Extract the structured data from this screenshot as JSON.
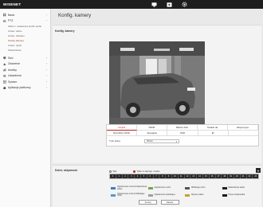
{
  "app": {
    "logo": "WISENET"
  },
  "header_icons": [
    "monitor-icon",
    "playback-icon",
    "settings-gear-icon"
  ],
  "sidebar": {
    "items": [
      {
        "label": "Basic",
        "icon": "grid-icon"
      },
      {
        "label": "PTZ",
        "icon": "ptz-icon"
      }
    ],
    "subitems": [
      {
        "label": "Wideo i ustawienia profilu audio",
        "active": false
      },
      {
        "label": "Ustaw. wideo",
        "active": false
      },
      {
        "label": "Ustaw. dźwięku",
        "active": false
      },
      {
        "label": "Konfig. kamery",
        "active": true
      },
      {
        "label": "Ustaw. ogóln.",
        "active": false
      },
      {
        "label": "Wskaźników",
        "active": false
      }
    ],
    "items2": [
      {
        "label": "Sieć",
        "icon": "network-icon"
      },
      {
        "label": "Zdarzenie",
        "icon": "event-icon"
      },
      {
        "label": "Analizy",
        "icon": "analytics-icon"
      },
      {
        "label": "Ustawienia",
        "icon": "settings-icon"
      },
      {
        "label": "System",
        "icon": "system-icon"
      },
      {
        "label": "Aplikacje platformy",
        "icon": "app-icon"
      }
    ]
  },
  "page": {
    "title": "Konfig. kamery"
  },
  "camera_section": {
    "label": "Konfig. kamery",
    "preset_label": "Preset obrazu",
    "preset_value": "Preset użytkownika",
    "tabs_row1": [
      "Czujnik",
      "SSDR",
      "Balans bieli",
      "Światło tła",
      "Ekspozycja"
    ],
    "tabs_row2": [
      "Dzień/Noc (D/N)",
      "Specjalne",
      "OSD",
      "IR"
    ],
    "active_tab": 0,
    "sensor_label": "Tryb pracy",
    "sensor_value": "Wideo"
  },
  "schedule_section": {
    "label": "Dzień, aktywność",
    "radio_off": "Wył.",
    "radio_on": "Tylko w zaprogr. czasie",
    "hours": [
      "0",
      "1",
      "2",
      "3",
      "4",
      "5",
      "6",
      "7",
      "8",
      "9",
      "10",
      "11",
      "12",
      "13",
      "14",
      "15",
      "16",
      "17",
      "18",
      "19",
      "20",
      "21",
      "22",
      "23"
    ],
    "legend": [
      {
        "label": "Ograniczenie ruchu & Nawiedzenie wideo",
        "color": "#3b7fc4"
      },
      {
        "label": "Ograniczenie ruchu",
        "color": "#7aa34e"
      },
      {
        "label": "Wilinkacje ruchu",
        "color": "#555555"
      },
      {
        "label": "Nawiedzenie wideo",
        "color": "#222222"
      },
      {
        "label": "Ograniczenie ruchu & Wilinkacje ruchu",
        "color": "#4f9bd6"
      },
      {
        "label": "Ograniczenie defokusjne",
        "color": "#a0a0a0"
      },
      {
        "label": "Wyrycie wideo",
        "color": "#c8a036"
      },
      {
        "label": "Preset użytkownika",
        "color": "#1a1a1a"
      }
    ]
  },
  "actions": {
    "cancel": "Anuluj",
    "apply": "Zastos."
  }
}
